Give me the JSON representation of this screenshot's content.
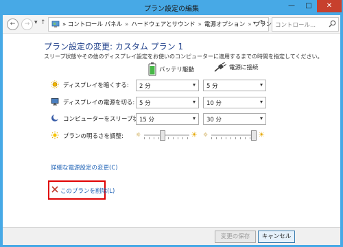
{
  "window": {
    "title": "プラン設定の編集",
    "controls": {
      "minimize": "—",
      "maximize": "□",
      "close": "✕"
    }
  },
  "nav": {
    "back_icon": "←",
    "forward_icon": "→",
    "dropdown_icon": "▾",
    "up_icon": "↑",
    "breadcrumb": [
      "コントロール パネル",
      "ハードウェアとサウンド",
      "電源オプション",
      "プラン設定の編集"
    ],
    "breadcrumb_prefix": "»",
    "refresh_icon": "↻",
    "search_placeholder": "コントロール...",
    "search_icon": "search-icon"
  },
  "main": {
    "heading": "プラン設定の変更: カスタム プラン 1",
    "description": "スリープ状態やその他のディスプレイ設定をお使いのコンピューターに適用するまでの時間を指定してください。",
    "columns": {
      "battery": "バッテリ駆動",
      "plugged": "電源に接続"
    },
    "rows": [
      {
        "label": "ディスプレイを暗くする:",
        "battery": "2 分",
        "plugged": "5 分",
        "icon": "dim-display-icon"
      },
      {
        "label": "ディスプレイの電源を切る:",
        "battery": "5 分",
        "plugged": "10 分",
        "icon": "monitor-icon"
      },
      {
        "label": "コンピューターをスリープ状態にする:",
        "battery": "15 分",
        "plugged": "30 分",
        "icon": "sleep-icon"
      }
    ],
    "brightness": {
      "label": "プランの明るさを調整:",
      "battery_level": 0.4,
      "plugged_level": 1.0
    },
    "advanced_link": "詳細な電源設定の変更(C)",
    "delete_link": "このプランを削除(L)"
  },
  "footer": {
    "save": "変更の保存",
    "cancel": "キャンセル"
  },
  "colors": {
    "title_bar": "#47a9e6",
    "heading": "#1e3f8a",
    "link": "#1a5fb4",
    "highlight": "#e00000"
  }
}
